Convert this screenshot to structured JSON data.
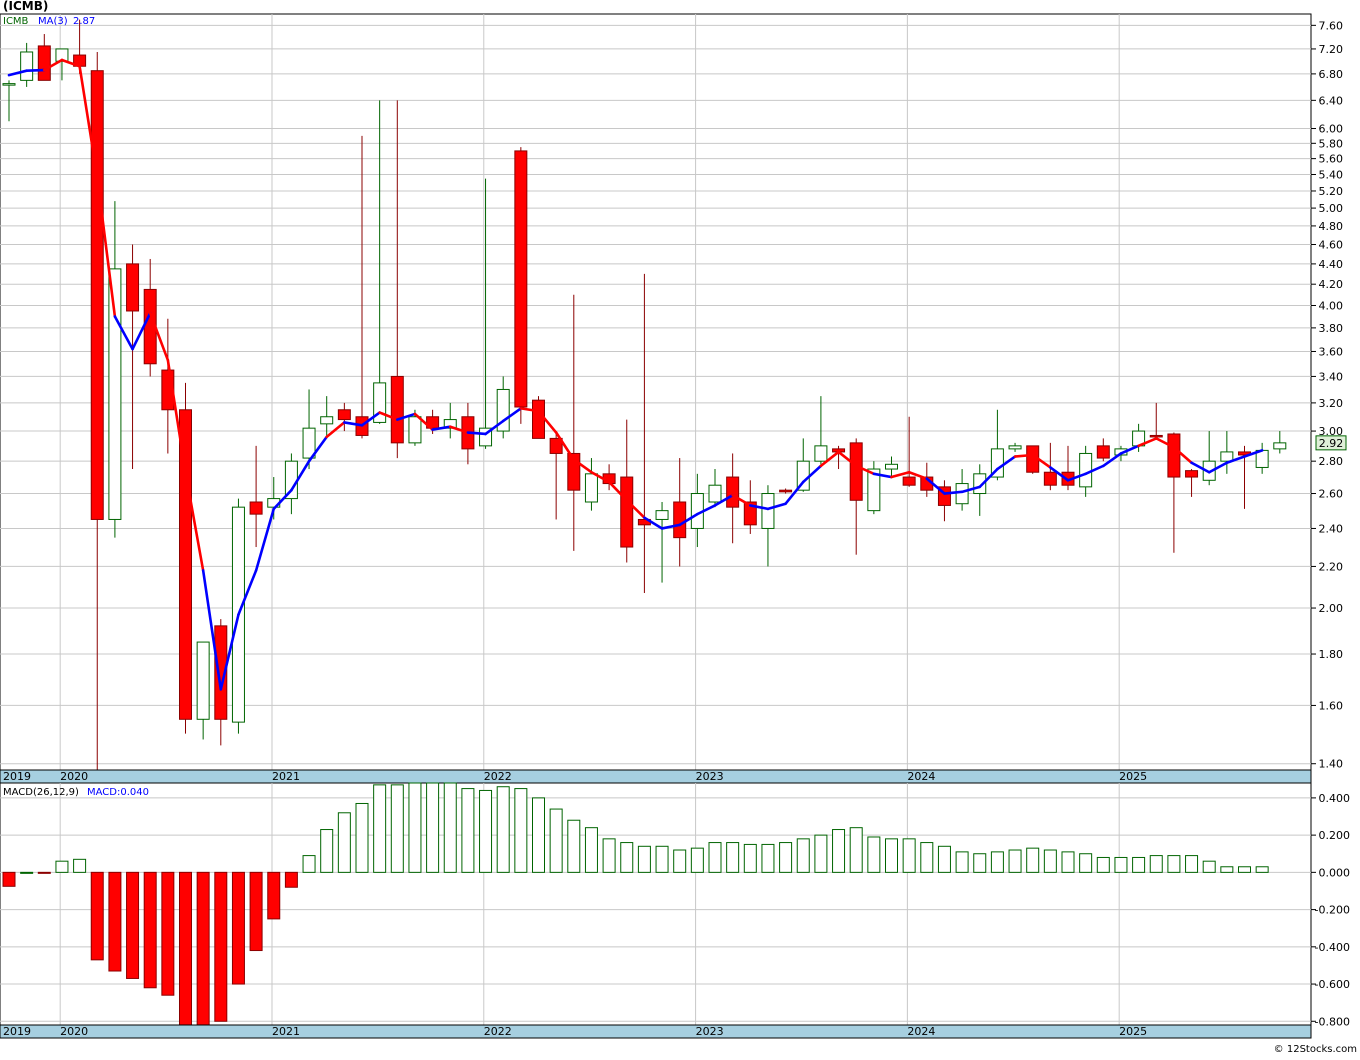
{
  "title": "(ICMB)",
  "footer": "© 12Stocks.com",
  "colors": {
    "up": "#006400",
    "down": "#ff0000",
    "ma_down": "#ff0000",
    "ma_up": "#0000ff",
    "grid": "#c8c8c8",
    "axis_band": "#a6cfe0",
    "macd_pos": "#006400",
    "macd_neg": "#ff0000",
    "last_label_bg": "#dff0d8"
  },
  "price_panel": {
    "legend": {
      "symbol": "ICMB",
      "ma_label": "MA(3)",
      "ma_value": "2.87"
    },
    "last_price_label": "2.92",
    "yaxis": {
      "scale": "log",
      "min": 1.38,
      "max": 7.8,
      "ticks": [
        "7.60",
        "7.20",
        "6.80",
        "6.40",
        "6.00",
        "5.80",
        "5.60",
        "5.40",
        "5.20",
        "5.00",
        "4.80",
        "4.60",
        "4.40",
        "4.20",
        "4.00",
        "3.80",
        "3.60",
        "3.40",
        "3.20",
        "3.00",
        "2.80",
        "2.60",
        "2.40",
        "2.20",
        "2.00",
        "1.80",
        "1.60",
        "1.40"
      ]
    }
  },
  "macd_panel": {
    "legend": {
      "label": "MACD(26,12,9)",
      "value_label": "MACD:0.040"
    },
    "yaxis": {
      "min": -0.82,
      "max": 0.48,
      "ticks": [
        "0.400",
        "0.200",
        "0.000",
        "-0.200",
        "-0.400",
        "-0.600",
        "-0.800"
      ]
    }
  },
  "time_axis": {
    "years": [
      {
        "label": "2019",
        "pos": -0.5
      },
      {
        "label": "2020",
        "pos": 2.9
      },
      {
        "label": "2021",
        "pos": 14.9
      },
      {
        "label": "2022",
        "pos": 26.9
      },
      {
        "label": "2023",
        "pos": 38.9
      },
      {
        "label": "2024",
        "pos": 50.9
      },
      {
        "label": "2025",
        "pos": 62.9
      }
    ]
  },
  "chart_data": {
    "type": "candlestick",
    "interval": "monthly",
    "count": 72,
    "ohlc": [
      [
        6.65,
        6.7,
        6.1,
        6.65
      ],
      [
        6.7,
        7.3,
        6.6,
        7.15
      ],
      [
        7.25,
        7.45,
        6.7,
        6.7
      ],
      [
        7.0,
        7.2,
        6.7,
        7.2
      ],
      [
        7.1,
        7.7,
        6.8,
        6.92
      ],
      [
        6.85,
        7.15,
        1.38,
        2.45
      ],
      [
        2.45,
        5.08,
        2.35,
        4.35
      ],
      [
        4.4,
        4.6,
        2.75,
        3.95
      ],
      [
        4.15,
        4.45,
        3.4,
        3.5
      ],
      [
        3.45,
        3.88,
        2.85,
        3.15
      ],
      [
        3.15,
        3.35,
        1.5,
        1.55
      ],
      [
        1.55,
        1.85,
        1.48,
        1.85
      ],
      [
        1.92,
        1.95,
        1.46,
        1.55
      ],
      [
        1.54,
        2.57,
        1.5,
        2.52
      ],
      [
        2.55,
        2.9,
        2.3,
        2.48
      ],
      [
        2.52,
        2.7,
        2.45,
        2.57
      ],
      [
        2.57,
        2.85,
        2.48,
        2.8
      ],
      [
        2.82,
        3.3,
        2.75,
        3.02
      ],
      [
        3.05,
        3.25,
        2.95,
        3.1
      ],
      [
        3.15,
        3.2,
        3.0,
        3.08
      ],
      [
        3.1,
        5.9,
        2.95,
        2.97
      ],
      [
        3.06,
        6.4,
        3.05,
        3.35
      ],
      [
        3.4,
        6.4,
        2.82,
        2.92
      ],
      [
        2.92,
        3.15,
        2.9,
        3.1
      ],
      [
        3.1,
        3.15,
        2.98,
        3.02
      ],
      [
        3.02,
        3.2,
        2.95,
        3.08
      ],
      [
        3.1,
        3.2,
        2.78,
        2.88
      ],
      [
        2.9,
        5.35,
        2.88,
        3.02
      ],
      [
        3.0,
        3.4,
        2.95,
        3.3
      ],
      [
        5.7,
        5.75,
        3.05,
        3.17
      ],
      [
        3.22,
        3.25,
        2.95,
        2.95
      ],
      [
        2.95,
        3.0,
        2.45,
        2.85
      ],
      [
        2.85,
        4.1,
        2.28,
        2.62
      ],
      [
        2.55,
        2.82,
        2.5,
        2.72
      ],
      [
        2.72,
        2.78,
        2.62,
        2.66
      ],
      [
        2.7,
        3.08,
        2.22,
        2.3
      ],
      [
        2.45,
        4.3,
        2.07,
        2.42
      ],
      [
        2.45,
        2.55,
        2.12,
        2.5
      ],
      [
        2.55,
        2.82,
        2.2,
        2.35
      ],
      [
        2.4,
        2.72,
        2.3,
        2.6
      ],
      [
        2.55,
        2.75,
        2.52,
        2.65
      ],
      [
        2.7,
        2.85,
        2.32,
        2.52
      ],
      [
        2.55,
        2.68,
        2.37,
        2.42
      ],
      [
        2.4,
        2.65,
        2.2,
        2.6
      ],
      [
        2.62,
        2.63,
        2.6,
        2.61
      ],
      [
        2.62,
        2.95,
        2.61,
        2.8
      ],
      [
        2.8,
        3.25,
        2.78,
        2.9
      ],
      [
        2.88,
        2.9,
        2.75,
        2.86
      ],
      [
        2.92,
        2.95,
        2.26,
        2.56
      ],
      [
        2.5,
        2.8,
        2.48,
        2.75
      ],
      [
        2.75,
        2.83,
        2.7,
        2.78
      ],
      [
        2.7,
        3.1,
        2.64,
        2.65
      ],
      [
        2.7,
        2.79,
        2.58,
        2.62
      ],
      [
        2.64,
        2.68,
        2.44,
        2.53
      ],
      [
        2.54,
        2.75,
        2.5,
        2.66
      ],
      [
        2.6,
        2.78,
        2.47,
        2.72
      ],
      [
        2.7,
        3.15,
        2.68,
        2.88
      ],
      [
        2.88,
        2.92,
        2.86,
        2.9
      ],
      [
        2.9,
        2.9,
        2.72,
        2.73
      ],
      [
        2.73,
        2.92,
        2.62,
        2.65
      ],
      [
        2.73,
        2.9,
        2.62,
        2.65
      ],
      [
        2.64,
        2.9,
        2.58,
        2.85
      ],
      [
        2.9,
        2.95,
        2.8,
        2.82
      ],
      [
        2.84,
        2.9,
        2.8,
        2.88
      ],
      [
        2.9,
        3.05,
        2.86,
        3.0
      ],
      [
        2.97,
        3.2,
        2.94,
        2.96
      ],
      [
        2.98,
        2.99,
        2.27,
        2.7
      ],
      [
        2.74,
        2.75,
        2.58,
        2.7
      ],
      [
        2.68,
        3.0,
        2.65,
        2.8
      ],
      [
        2.8,
        3.0,
        2.72,
        2.86
      ],
      [
        2.86,
        2.9,
        2.51,
        2.84
      ],
      [
        2.76,
        2.92,
        2.72,
        2.87
      ],
      [
        2.88,
        3.0,
        2.85,
        2.92
      ]
    ],
    "ma3": [
      6.78,
      6.85,
      6.86,
      7.02,
      6.92,
      5.37,
      3.9,
      3.62,
      3.93,
      3.53,
      2.73,
      2.18,
      1.66,
      1.97,
      2.18,
      2.51,
      2.62,
      2.8,
      2.96,
      3.06,
      3.04,
      3.13,
      3.08,
      3.12,
      3.01,
      3.03,
      2.99,
      2.98,
      3.07,
      3.16,
      3.14,
      2.99,
      2.81,
      2.73,
      2.67,
      2.56,
      2.46,
      2.4,
      2.42,
      2.48,
      2.53,
      2.59,
      2.53,
      2.51,
      2.54,
      2.67,
      2.77,
      2.86,
      2.77,
      2.72,
      2.7,
      2.73,
      2.69,
      2.6,
      2.61,
      2.64,
      2.75,
      2.83,
      2.84,
      2.76,
      2.68,
      2.72,
      2.77,
      2.85,
      2.9,
      2.95,
      2.89,
      2.79,
      2.73,
      2.79,
      2.83,
      2.87
    ],
    "ma3_trend": [
      "up",
      "up",
      "up",
      "down",
      "down",
      "down",
      "down",
      "up",
      "up",
      "down",
      "down",
      "down",
      "up",
      "up",
      "up",
      "up",
      "up",
      "up",
      "up",
      "down",
      "up",
      "up",
      "down",
      "up",
      "down",
      "up",
      "down",
      "up",
      "up",
      "up",
      "down",
      "down",
      "down",
      "down",
      "down",
      "down",
      "down",
      "up",
      "up",
      "up",
      "up",
      "up",
      "down",
      "up",
      "up",
      "up",
      "up",
      "down",
      "down",
      "down",
      "up",
      "down",
      "down",
      "up",
      "up",
      "up",
      "up",
      "up",
      "down",
      "down",
      "up",
      "up",
      "up",
      "up",
      "up",
      "down",
      "down",
      "down",
      "up",
      "up",
      "up",
      "up"
    ],
    "macd": [
      -0.075,
      0.0,
      -0.005,
      0.06,
      0.07,
      -0.47,
      -0.53,
      -0.57,
      -0.62,
      -0.66,
      -0.82,
      -0.84,
      -0.8,
      -0.6,
      -0.42,
      -0.25,
      -0.08,
      0.09,
      0.23,
      0.32,
      0.37,
      0.47,
      0.47,
      0.48,
      0.48,
      0.48,
      0.45,
      0.44,
      0.46,
      0.45,
      0.4,
      0.34,
      0.28,
      0.24,
      0.18,
      0.16,
      0.14,
      0.14,
      0.12,
      0.13,
      0.16,
      0.16,
      0.15,
      0.15,
      0.16,
      0.18,
      0.2,
      0.23,
      0.24,
      0.19,
      0.18,
      0.18,
      0.16,
      0.14,
      0.11,
      0.1,
      0.11,
      0.12,
      0.13,
      0.12,
      0.11,
      0.1,
      0.08,
      0.08,
      0.08,
      0.09,
      0.09,
      0.09,
      0.06,
      0.03,
      0.03,
      0.03
    ]
  }
}
